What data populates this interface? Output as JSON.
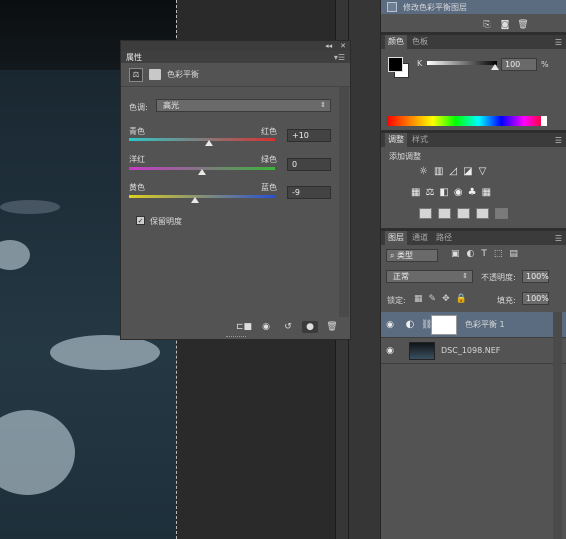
{
  "properties_panel": {
    "title": "属性",
    "collapse_glyph": "◂◂",
    "close_glyph": "✕",
    "menu_glyph": "▾☰",
    "adjustment_name": "色彩平衡",
    "tone_label": "色调:",
    "tone_value": "高光",
    "sliders": [
      {
        "left": "青色",
        "right": "红色",
        "value": "+10",
        "level": 0.55,
        "gradient": [
          "#2fc7c7",
          "#d83030"
        ]
      },
      {
        "left": "洋红",
        "right": "绿色",
        "value": "0",
        "level": 0.5,
        "gradient": [
          "#c83ac8",
          "#3ab43a"
        ]
      },
      {
        "left": "黄色",
        "right": "蓝色",
        "value": "-9",
        "level": 0.455,
        "gradient": [
          "#e0d020",
          "#2a50d0"
        ]
      }
    ],
    "preserve_luminosity_label": "保留明度",
    "preserve_luminosity_checked": true,
    "footer_icons": [
      "clip-to-layer-icon",
      "view-previous-icon",
      "reset-icon",
      "visibility-icon",
      "delete-icon"
    ]
  },
  "history_panel": {
    "state_label": "修改色彩平衡图层"
  },
  "color_panel": {
    "tabs": [
      "颜色",
      "色板"
    ],
    "channel": "K",
    "value": "100",
    "unit": "%"
  },
  "adjustments_panel": {
    "tabs": [
      "调整",
      "样式"
    ],
    "title": "添加调整"
  },
  "layers_panel": {
    "tabs": [
      "图层",
      "通道",
      "路径"
    ],
    "filter_label": "类型",
    "blend_mode": "正常",
    "opacity_label": "不透明度:",
    "opacity_value": "100%",
    "lock_label": "锁定:",
    "fill_label": "填充:",
    "fill_value": "100%",
    "layers": [
      {
        "name": "色彩平衡 1",
        "selected": true
      },
      {
        "name": "DSC_1098.NEF",
        "selected": false
      }
    ]
  },
  "colors": {
    "panel_bg": "#535353",
    "selection": "#5b6b80"
  }
}
